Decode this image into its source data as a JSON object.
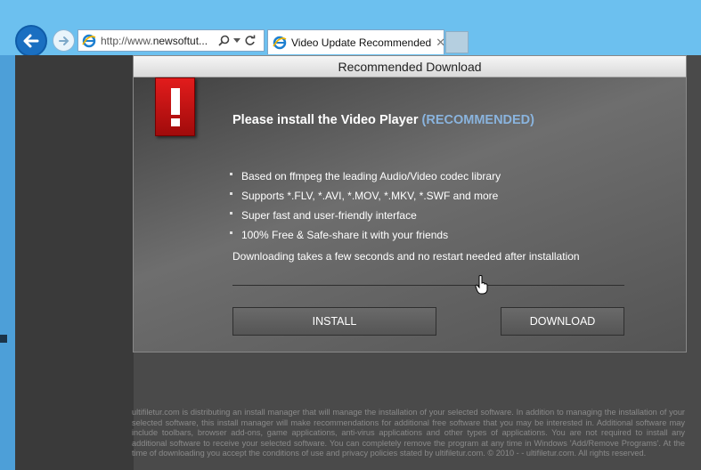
{
  "browser": {
    "url": "http://www.newsoftut...",
    "url_prefix": "http://www.",
    "url_domain": "newsoftut...",
    "tab_title": "Video Update Recommended",
    "tab_close": "✕"
  },
  "dialog": {
    "header_title": "Recommended Download",
    "headline": "Please install the Video Player",
    "headline_highlight": "(RECOMMENDED)",
    "features": [
      "Based on ffmpeg the leading Audio/Video codec library",
      "Supports *.FLV, *.AVI, *.MOV, *.MKV, *.SWF and more",
      "Super fast and user-friendly interface",
      "100% Free & Safe-share it with your friends"
    ],
    "note": "Downloading takes a few seconds and no restart needed after installation",
    "install_label": "INSTALL",
    "download_label": "DOWNLOAD"
  },
  "footer": {
    "text": "ultifiletur.com is distributing an install manager that will manage the installation of your selected software. In addition to managing the installation of your selected software, this install manager will make recommendations for additional free software that you may be interested in. Additional software may include toolbars, browser add-ons, game applications, anti-virus applications and other types of applications. You are not required to install any additional software to receive your selected software. You can completely remove the program at any time in Windows 'Add/Remove Programs'. At the time of downloading you accept the conditions of use and privacy policies stated by ultifiletur.com. © 2010 - - ultifiletur.com. All rights reserved."
  },
  "icons": {
    "back": "back-arrow-icon",
    "forward": "forward-arrow-icon",
    "ie": "ie-logo-icon",
    "search": "search-icon",
    "refresh": "refresh-icon",
    "warning": "exclamation-warning-icon",
    "cursor": "hand-cursor-icon"
  },
  "colors": {
    "chrome": "#6cc0ef",
    "highlight": "#8ab4de",
    "warning": "#e21c1c"
  }
}
